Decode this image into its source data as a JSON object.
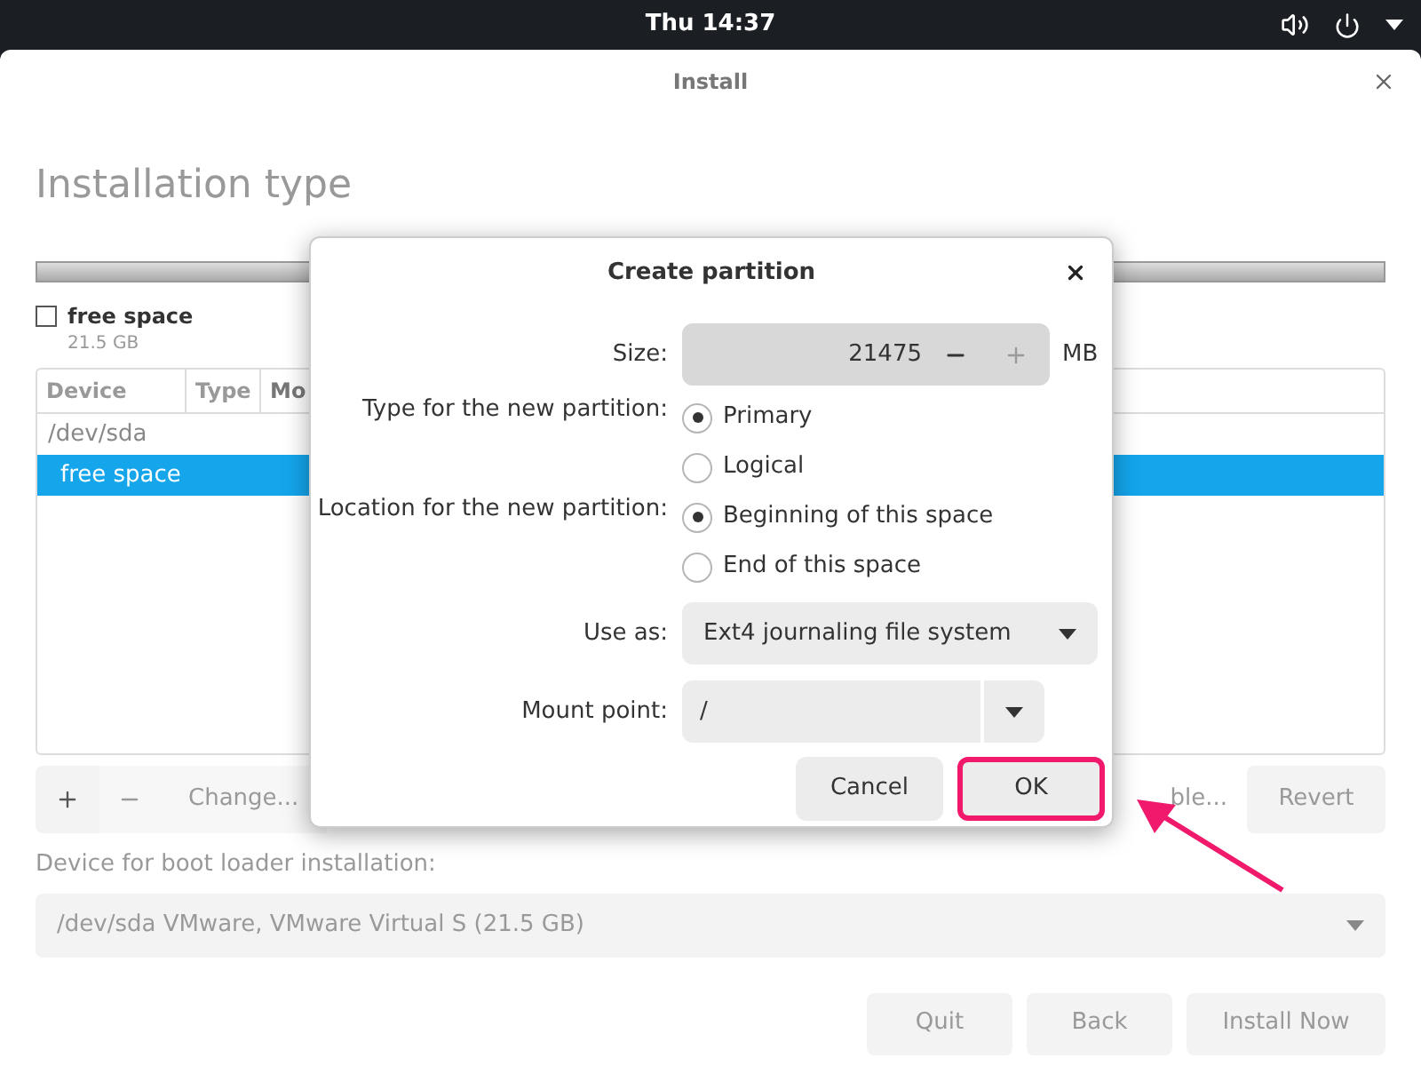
{
  "top_bar": {
    "clock": "Thu 14:37"
  },
  "window": {
    "title": "Install",
    "heading": "Installation type",
    "legend": {
      "label": "free space",
      "size": "21.5 GB"
    },
    "table": {
      "columns": [
        "Device",
        "Type",
        "Mo"
      ],
      "rows": [
        {
          "device": "/dev/sda",
          "selected": false,
          "children": [
            {
              "device": "free space",
              "selected": true
            }
          ]
        }
      ]
    },
    "toolbar": {
      "change": "Change...",
      "table": "ble...",
      "revert": "Revert"
    },
    "boot_loader": {
      "label": "Device for boot loader installation:",
      "value": "/dev/sda VMware, VMware Virtual S (21.5 GB)"
    },
    "buttons": [
      "Quit",
      "Back",
      "Install Now"
    ]
  },
  "dialog": {
    "title": "Create partition",
    "size": {
      "label": "Size:",
      "value": "21475",
      "unit": "MB"
    },
    "type": {
      "label": "Type for the new partition:",
      "options": [
        {
          "label": "Primary",
          "selected": true
        },
        {
          "label": "Logical",
          "selected": false
        }
      ]
    },
    "location": {
      "label": "Location for the new partition:",
      "options": [
        {
          "label": "Beginning of this space",
          "selected": true
        },
        {
          "label": "End of this space",
          "selected": false
        }
      ]
    },
    "use_as": {
      "label": "Use as:",
      "value": "Ext4 journaling file system"
    },
    "mount_point": {
      "label": "Mount point:",
      "value": "/"
    },
    "buttons": [
      {
        "label": "Cancel",
        "highlighted": false
      },
      {
        "label": "OK",
        "highlighted": true
      }
    ]
  }
}
